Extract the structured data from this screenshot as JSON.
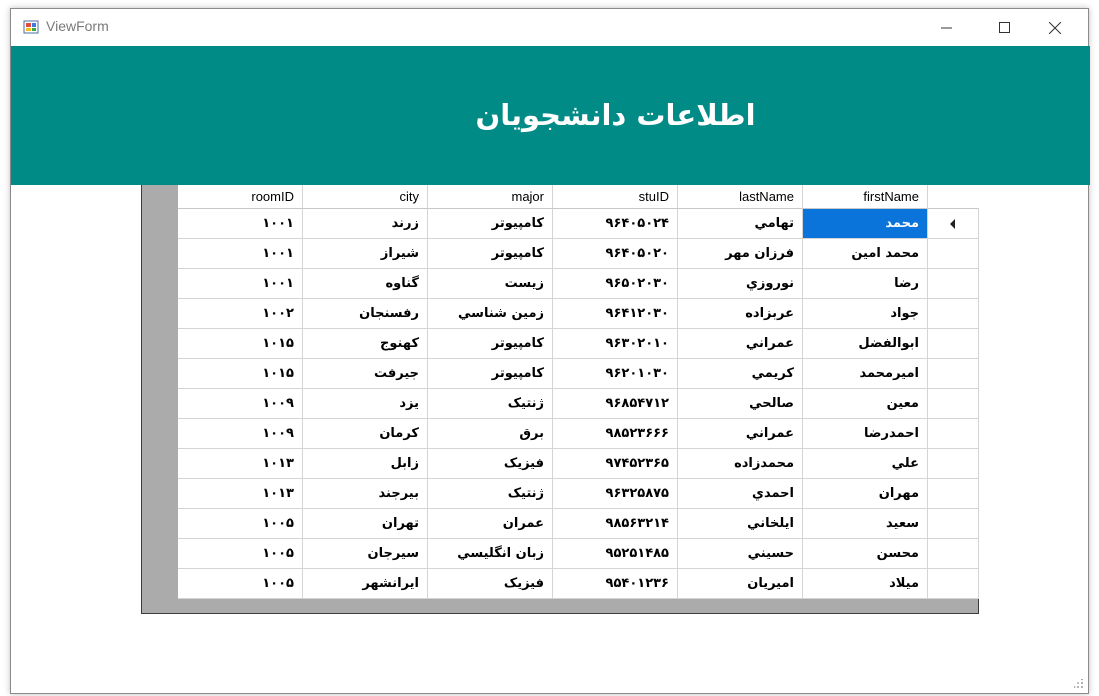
{
  "window": {
    "title": "ViewForm"
  },
  "header": {
    "title": "اطلاعات دانشجويان",
    "color": "#008b87"
  },
  "grid": {
    "columns": {
      "roomID": "roomID",
      "city": "city",
      "major": "major",
      "stuID": "stuID",
      "lastName": "lastName",
      "firstName": "firstName"
    },
    "rows": [
      {
        "roomID": "۱۰۰۱",
        "city": "زرند",
        "major": "کامپيوتر",
        "stuID": "۹۶۴۰۵۰۲۴",
        "lastName": "تهامي",
        "firstName": "محمد"
      },
      {
        "roomID": "۱۰۰۱",
        "city": "شيراز",
        "major": "کامپيوتر",
        "stuID": "۹۶۴۰۵۰۲۰",
        "lastName": "فرزان مهر",
        "firstName": "محمد امين"
      },
      {
        "roomID": "۱۰۰۱",
        "city": "گناوه",
        "major": "زيست",
        "stuID": "۹۶۵۰۲۰۳۰",
        "lastName": "نوروزي",
        "firstName": "رضا"
      },
      {
        "roomID": "۱۰۰۲",
        "city": "رفسنجان",
        "major": "زمين شناسي",
        "stuID": "۹۶۴۱۲۰۳۰",
        "lastName": "عربزاده",
        "firstName": "جواد"
      },
      {
        "roomID": "۱۰۱۵",
        "city": "کهنوج",
        "major": "کامپيوتر",
        "stuID": "۹۶۳۰۲۰۱۰",
        "lastName": "عمراني",
        "firstName": "ابوالفضل"
      },
      {
        "roomID": "۱۰۱۵",
        "city": "جيرفت",
        "major": "کامپيوتر",
        "stuID": "۹۶۲۰۱۰۳۰",
        "lastName": "کريمي",
        "firstName": "اميرمحمد"
      },
      {
        "roomID": "۱۰۰۹",
        "city": "يزد",
        "major": "ژنتيک",
        "stuID": "۹۶۸۵۴۷۱۲",
        "lastName": "صالحي",
        "firstName": "معين"
      },
      {
        "roomID": "۱۰۰۹",
        "city": "کرمان",
        "major": "برق",
        "stuID": "۹۸۵۲۳۶۶۶",
        "lastName": "عمراني",
        "firstName": "احمدرضا"
      },
      {
        "roomID": "۱۰۱۳",
        "city": "زابل",
        "major": "فيزيک",
        "stuID": "۹۷۴۵۲۳۶۵",
        "lastName": "محمدزاده",
        "firstName": "علي"
      },
      {
        "roomID": "۱۰۱۳",
        "city": "بيرجند",
        "major": "ژنتيک",
        "stuID": "۹۶۳۲۵۸۷۵",
        "lastName": "احمدي",
        "firstName": "مهران"
      },
      {
        "roomID": "۱۰۰۵",
        "city": "تهران",
        "major": "عمران",
        "stuID": "۹۸۵۶۳۲۱۴",
        "lastName": "ايلخاني",
        "firstName": "سعيد"
      },
      {
        "roomID": "۱۰۰۵",
        "city": "سيرجان",
        "major": "زبان انگليسي",
        "stuID": "۹۵۲۵۱۴۸۵",
        "lastName": "حسيني",
        "firstName": "محسن"
      },
      {
        "roomID": "۱۰۰۵",
        "city": "ايرانشهر",
        "major": "فيزيک",
        "stuID": "۹۵۴۰۱۲۳۶",
        "lastName": "اميريان",
        "firstName": "ميلاد"
      }
    ],
    "selected_row": 0,
    "selection_color": "#0a74da"
  }
}
